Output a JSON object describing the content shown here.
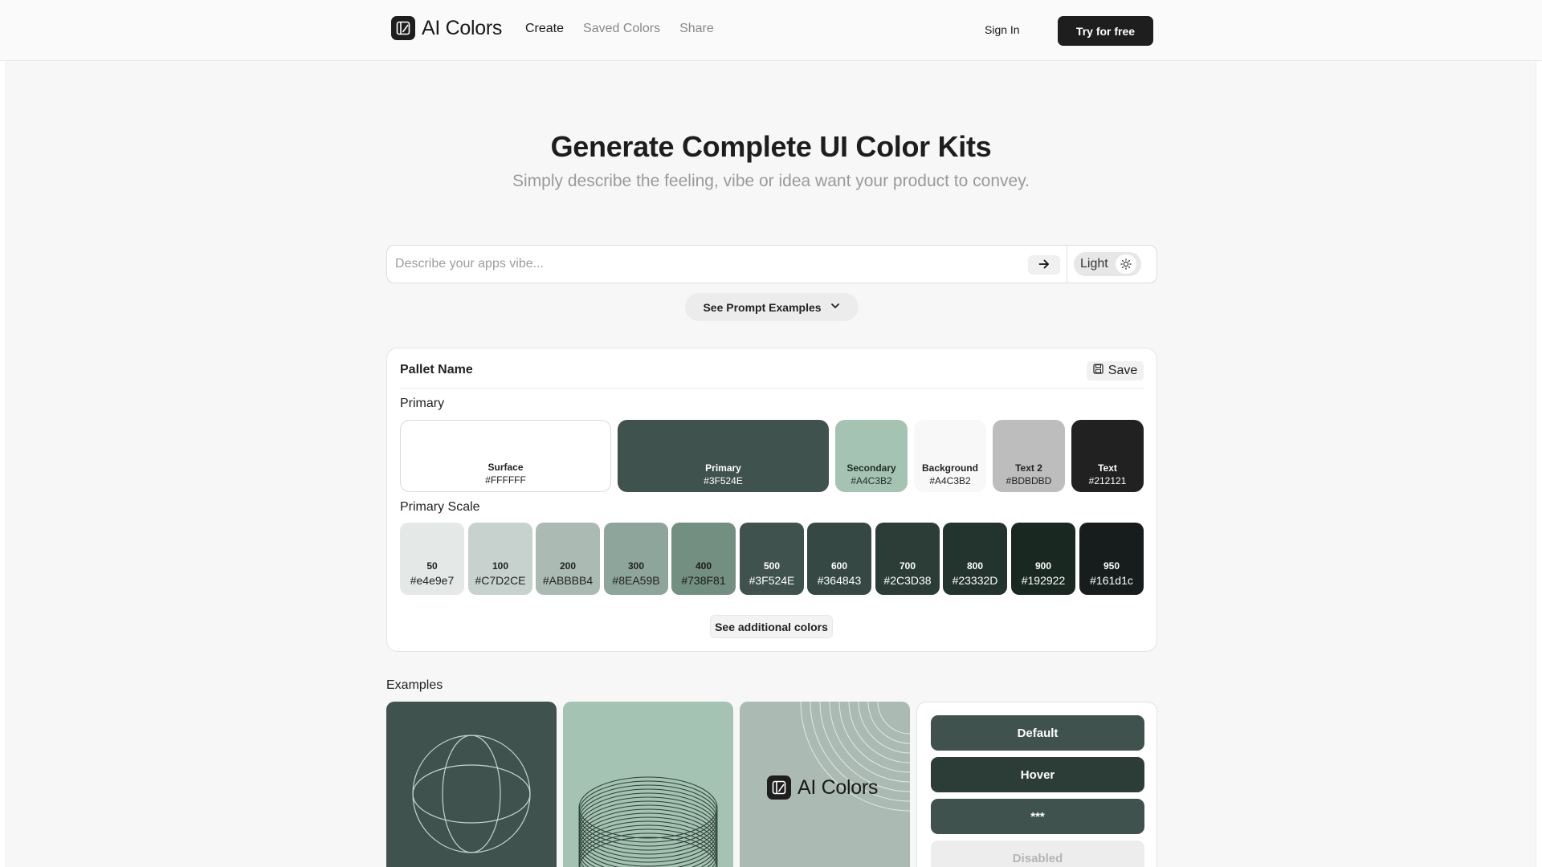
{
  "header": {
    "brand": "AI Colors",
    "nav": [
      {
        "label": "Create"
      },
      {
        "label": "Saved Colors"
      },
      {
        "label": "Share"
      }
    ],
    "sign_in": "Sign In",
    "try_free": "Try for free"
  },
  "hero": {
    "title": "Generate Complete UI Color Kits",
    "subtitle": "Simply describe the feeling, vibe or idea want your product to convey."
  },
  "prompt": {
    "value": "",
    "placeholder": "Describe your apps vibe...",
    "mode_label": "Light",
    "examples_button": "See Prompt Examples"
  },
  "palette": {
    "name": "Pallet Name",
    "save_label": "Save",
    "primary_label": "Primary",
    "swatches": [
      {
        "name": "Surface",
        "hex": "#FFFFFF",
        "color": "#ffffff",
        "text_color": "#222222"
      },
      {
        "name": "Primary",
        "hex": "#3F524E",
        "color": "#3f524e",
        "text_color": "#ffffff"
      },
      {
        "name": "Secondary",
        "hex": "#A4C3B2",
        "color": "#a4c3b2",
        "text_color": "#1f2d28"
      },
      {
        "name": "Background",
        "hex": "#A4C3B2",
        "color": "#f8f8f8",
        "text_color": "#222222"
      },
      {
        "name": "Text 2",
        "hex": "#BDBDBD",
        "color": "#bdbdbd",
        "text_color": "#222222"
      },
      {
        "name": "Text",
        "hex": "#212121",
        "color": "#212121",
        "text_color": "#ffffff"
      }
    ],
    "scale_label": "Primary Scale",
    "scale": [
      {
        "step": "50",
        "hex": "#e4e9e7",
        "color": "#e4e9e7",
        "text_color": "#222222"
      },
      {
        "step": "100",
        "hex": "#C7D2CE",
        "color": "#c7d2ce",
        "text_color": "#222222"
      },
      {
        "step": "200",
        "hex": "#ABBBB4",
        "color": "#abbbb4",
        "text_color": "#222222"
      },
      {
        "step": "300",
        "hex": "#8EA59B",
        "color": "#8ea59b",
        "text_color": "#222222"
      },
      {
        "step": "400",
        "hex": "#738F81",
        "color": "#738f81",
        "text_color": "#1a1a1a"
      },
      {
        "step": "500",
        "hex": "#3F524E",
        "color": "#3f524e",
        "text_color": "#ffffff"
      },
      {
        "step": "600",
        "hex": "#364843",
        "color": "#364843",
        "text_color": "#ffffff"
      },
      {
        "step": "700",
        "hex": "#2C3D38",
        "color": "#2c3d38",
        "text_color": "#ffffff"
      },
      {
        "step": "800",
        "hex": "#23332D",
        "color": "#23332d",
        "text_color": "#ffffff"
      },
      {
        "step": "900",
        "hex": "#192922",
        "color": "#192922",
        "text_color": "#ffffff"
      },
      {
        "step": "950",
        "hex": "#161d1c",
        "color": "#161d1c",
        "text_color": "#ffffff"
      }
    ],
    "additional_button": "See additional colors"
  },
  "examples": {
    "label": "Examples",
    "card3_brand": "AI Colors",
    "states": {
      "default": "Default",
      "hover": "Hover",
      "active": "***",
      "disabled": "Disabled"
    }
  },
  "icons": {
    "brand_logo": "logo-mark-icon",
    "send": "arrow-right-icon",
    "mode": "sun-icon",
    "dropdown": "chevron-down-icon",
    "save": "floppy-disk-icon"
  }
}
